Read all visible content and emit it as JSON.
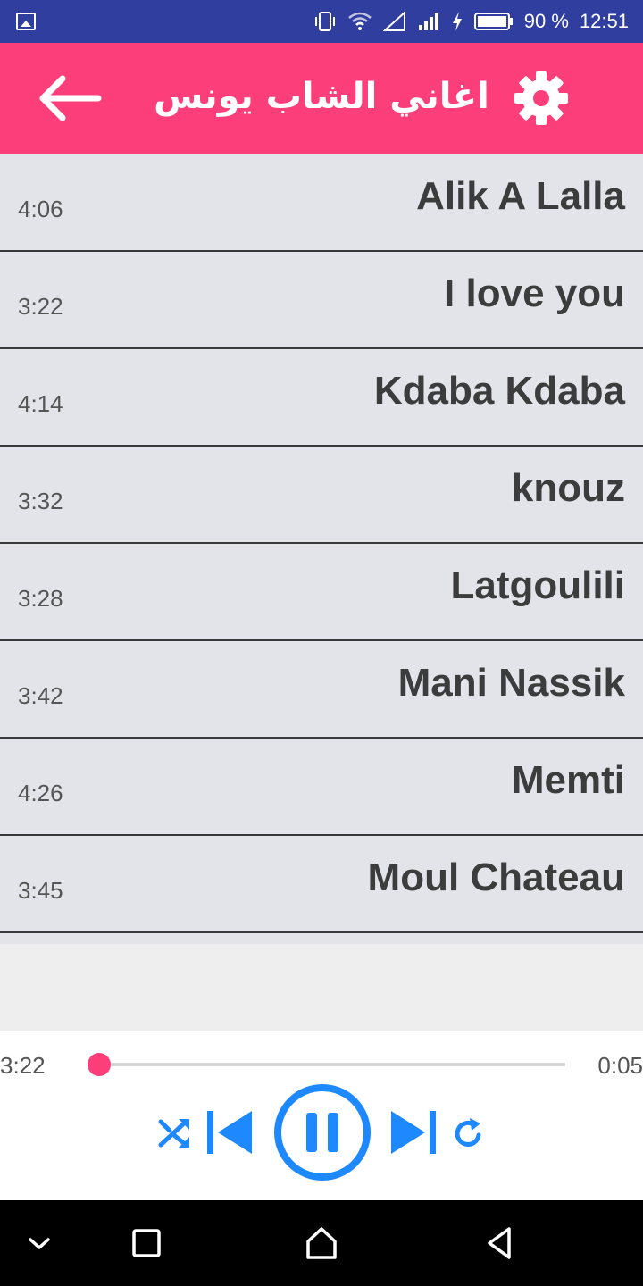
{
  "status_bar": {
    "battery_text": "90 %",
    "time": "12:51",
    "icons": [
      "gallery-icon",
      "vibrate-icon",
      "wifi-icon",
      "signal-empty-icon",
      "signal-icon",
      "charging-icon",
      "battery-icon"
    ]
  },
  "app_bar": {
    "title": "اغاني الشاب يونس",
    "back_icon": "arrow-left-icon",
    "settings_icon": "gear-icon",
    "color": "#fc3f7a"
  },
  "songs": [
    {
      "title": "Alik A Lalla",
      "duration": "4:06"
    },
    {
      "title": "I love you",
      "duration": "3:22"
    },
    {
      "title": "Kdaba Kdaba",
      "duration": "4:14"
    },
    {
      "title": "knouz",
      "duration": "3:32"
    },
    {
      "title": "Latgoulili",
      "duration": "3:28"
    },
    {
      "title": "Mani Nassik",
      "duration": "3:42"
    },
    {
      "title": "Memti",
      "duration": "4:26"
    },
    {
      "title": "Moul Chateau",
      "duration": "3:45"
    }
  ],
  "player": {
    "current_time": "3:22",
    "total_time": "0:05",
    "progress_fraction": 0.02,
    "accent_color": "#1e88ff",
    "controls": [
      "shuffle-icon",
      "previous-icon",
      "pause-icon",
      "next-icon",
      "repeat-icon"
    ]
  },
  "nav_bar": {
    "icons": [
      "chevron-down-icon",
      "recents-icon",
      "home-icon",
      "back-icon"
    ]
  }
}
